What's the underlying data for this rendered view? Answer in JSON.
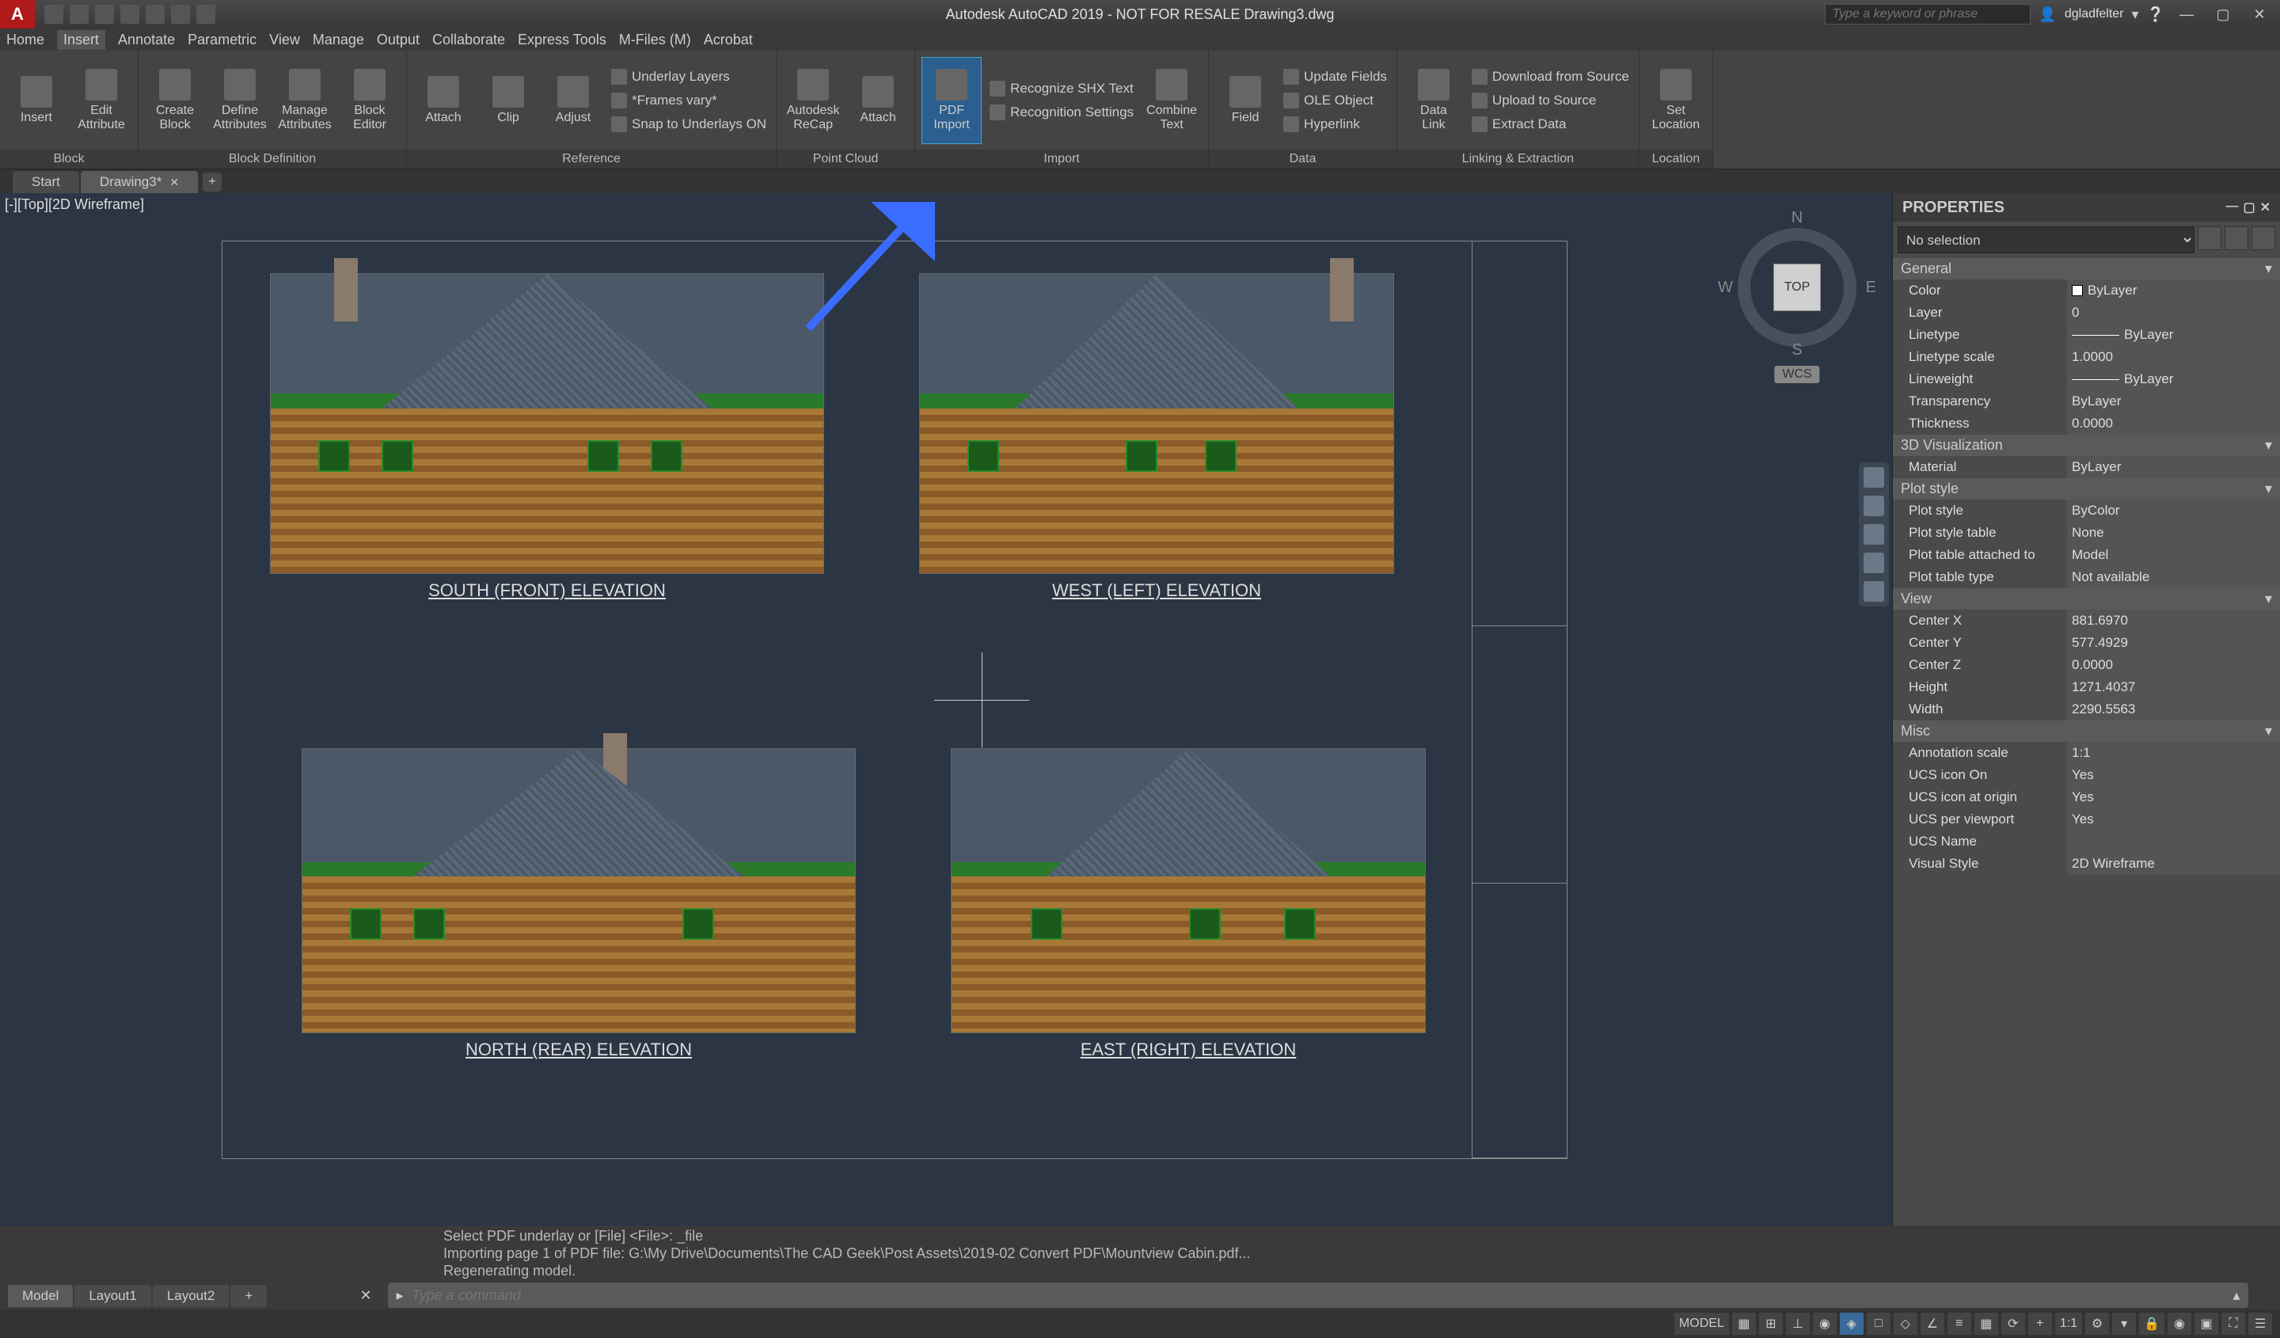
{
  "titlebar": {
    "app_letter": "A",
    "title": "Autodesk AutoCAD 2019 - NOT FOR RESALE    Drawing3.dwg",
    "search_placeholder": "Type a keyword or phrase",
    "username": "dgladfelter"
  },
  "menubar": {
    "items": [
      "Home",
      "Insert",
      "Annotate",
      "Parametric",
      "View",
      "Manage",
      "Output",
      "Collaborate",
      "Express Tools",
      "M-Files (M)",
      "Acrobat"
    ]
  },
  "ribbon": {
    "panels": [
      {
        "title": "Block",
        "big": [
          {
            "label": "Insert"
          },
          {
            "label": "Edit\nAttribute"
          }
        ]
      },
      {
        "title": "Block Definition",
        "big": [
          {
            "label": "Create\nBlock"
          },
          {
            "label": "Define\nAttributes"
          },
          {
            "label": "Manage\nAttributes"
          },
          {
            "label": "Block\nEditor"
          }
        ]
      },
      {
        "title": "Reference",
        "big": [
          {
            "label": "Attach"
          },
          {
            "label": "Clip"
          },
          {
            "label": "Adjust"
          }
        ],
        "small": [
          "Underlay Layers",
          "*Frames vary*",
          "Snap to Underlays ON"
        ]
      },
      {
        "title": "Point Cloud",
        "big": [
          {
            "label": "Autodesk\nReCap"
          },
          {
            "label": "Attach"
          }
        ]
      },
      {
        "title": "Import",
        "big": [
          {
            "label": "PDF\nImport",
            "highlight": true
          }
        ],
        "small": [
          "Recognize SHX Text",
          "Recognition Settings"
        ],
        "big2": [
          {
            "label": "Combine\nText"
          }
        ]
      },
      {
        "title": "Data",
        "big": [
          {
            "label": "Field"
          }
        ],
        "small": [
          "Update Fields",
          "OLE Object",
          "Hyperlink"
        ]
      },
      {
        "title": "Linking & Extraction",
        "big": [
          {
            "label": "Data\nLink"
          }
        ],
        "small": [
          "Download from Source",
          "Upload to Source",
          "Extract Data"
        ]
      },
      {
        "title": "Location",
        "big": [
          {
            "label": "Set\nLocation"
          }
        ]
      }
    ]
  },
  "doctabs": {
    "tabs": [
      {
        "label": "Start",
        "active": false
      },
      {
        "label": "Drawing3*",
        "active": true
      }
    ]
  },
  "viewport": {
    "label": "[-][Top][2D Wireframe]",
    "elevations": [
      {
        "title": "SOUTH (FRONT) ELEVATION"
      },
      {
        "title": "WEST (LEFT) ELEVATION"
      },
      {
        "title": "NORTH (REAR) ELEVATION"
      },
      {
        "title": "EAST (RIGHT) ELEVATION"
      }
    ],
    "viewcube": {
      "n": "N",
      "s": "S",
      "e": "E",
      "w": "W",
      "face": "TOP",
      "wcs": "WCS"
    }
  },
  "properties": {
    "title": "PROPERTIES",
    "selection": "No selection",
    "sections": [
      {
        "name": "General",
        "rows": [
          {
            "k": "Color",
            "v": "ByLayer",
            "swatch": true
          },
          {
            "k": "Layer",
            "v": "0"
          },
          {
            "k": "Linetype",
            "v": "ByLayer",
            "line": true
          },
          {
            "k": "Linetype scale",
            "v": "1.0000"
          },
          {
            "k": "Lineweight",
            "v": "ByLayer",
            "line": true
          },
          {
            "k": "Transparency",
            "v": "ByLayer"
          },
          {
            "k": "Thickness",
            "v": "0.0000"
          }
        ]
      },
      {
        "name": "3D Visualization",
        "rows": [
          {
            "k": "Material",
            "v": "ByLayer"
          }
        ]
      },
      {
        "name": "Plot style",
        "rows": [
          {
            "k": "Plot style",
            "v": "ByColor"
          },
          {
            "k": "Plot style table",
            "v": "None"
          },
          {
            "k": "Plot table attached to",
            "v": "Model"
          },
          {
            "k": "Plot table type",
            "v": "Not available"
          }
        ]
      },
      {
        "name": "View",
        "rows": [
          {
            "k": "Center X",
            "v": "881.6970"
          },
          {
            "k": "Center Y",
            "v": "577.4929"
          },
          {
            "k": "Center Z",
            "v": "0.0000"
          },
          {
            "k": "Height",
            "v": "1271.4037"
          },
          {
            "k": "Width",
            "v": "2290.5563"
          }
        ]
      },
      {
        "name": "Misc",
        "rows": [
          {
            "k": "Annotation scale",
            "v": "1:1"
          },
          {
            "k": "UCS icon On",
            "v": "Yes"
          },
          {
            "k": "UCS icon at origin",
            "v": "Yes"
          },
          {
            "k": "UCS per viewport",
            "v": "Yes"
          },
          {
            "k": "UCS Name",
            "v": ""
          },
          {
            "k": "Visual Style",
            "v": "2D Wireframe"
          }
        ]
      }
    ]
  },
  "cmdline": {
    "history": [
      "Select PDF underlay or [File] <File>: _file",
      "Importing page 1 of PDF file: G:\\My Drive\\Documents\\The CAD Geek\\Post Assets\\2019-02 Convert PDF\\Mountview Cabin.pdf...",
      "Regenerating model."
    ],
    "placeholder": "Type a command"
  },
  "layouttabs": {
    "tabs": [
      "Model",
      "Layout1",
      "Layout2"
    ]
  },
  "statusbar": {
    "model": "MODEL",
    "scale": "1:1"
  }
}
